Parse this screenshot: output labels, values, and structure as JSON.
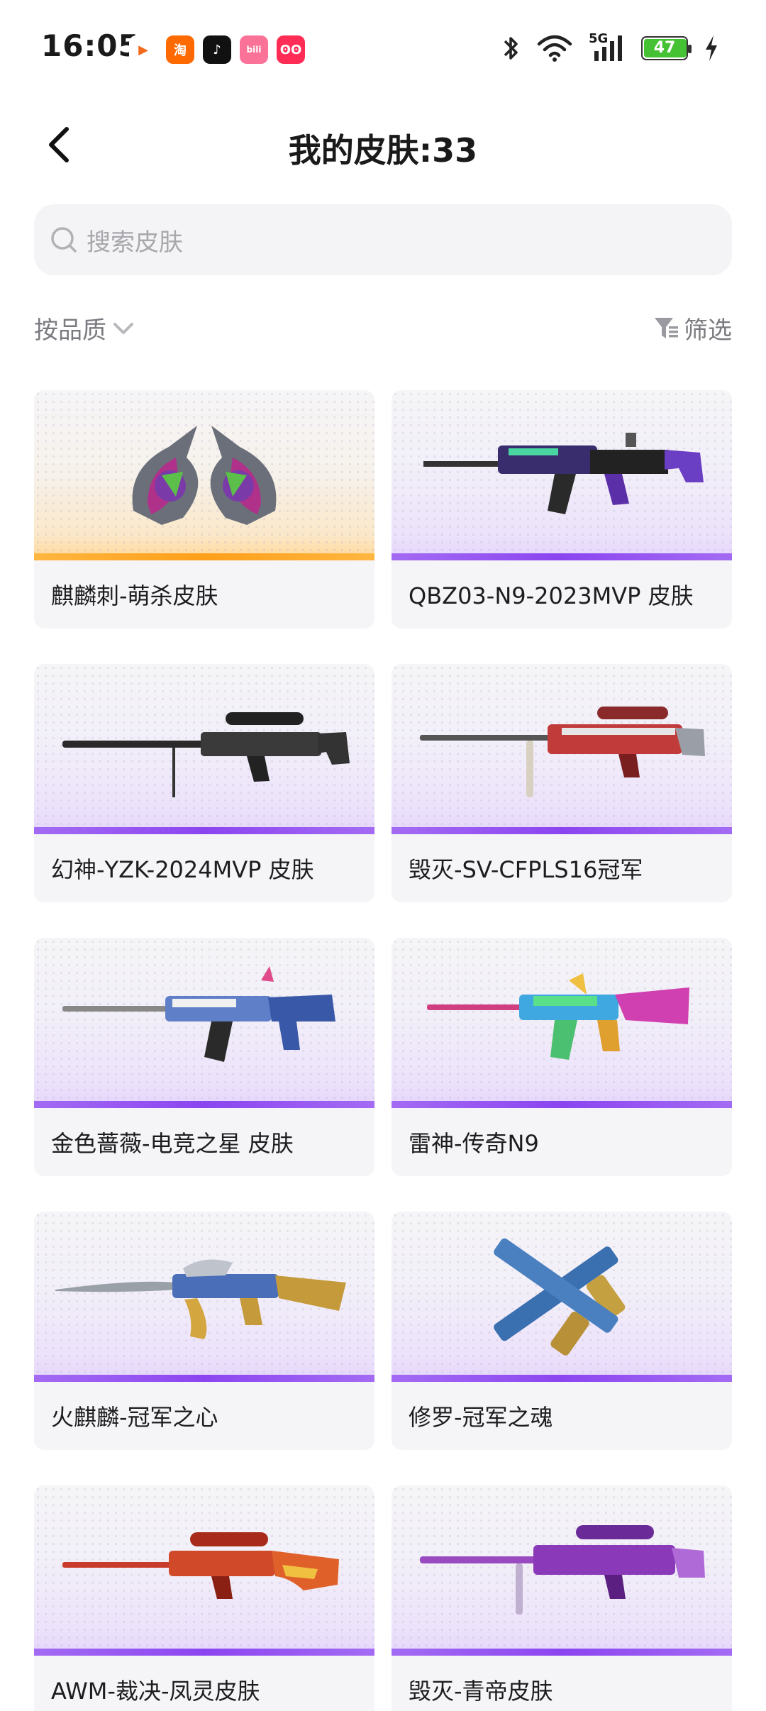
{
  "status_bar": {
    "time": "16:05",
    "apps": [
      {
        "name": "photo-app-icon",
        "glyph": "▶",
        "color": "#ffffff",
        "fg": "#f26b1d"
      },
      {
        "name": "taobao-icon",
        "glyph": "淘",
        "color": "#ff6a00",
        "fg": "#ffffff"
      },
      {
        "name": "douyin-icon",
        "glyph": "♪",
        "color": "#111111",
        "fg": "#ffffff"
      },
      {
        "name": "bilibili-icon",
        "glyph": "bili",
        "color": "#fb7299",
        "fg": "#ffffff"
      },
      {
        "name": "pig-app-icon",
        "glyph": "ʘʘ",
        "color": "#ff2d55",
        "fg": "#ffffff"
      }
    ],
    "network": "5G",
    "battery": "47",
    "battery_level": 0.47
  },
  "header": {
    "title": "我的皮肤:33"
  },
  "search": {
    "placeholder": "搜索皮肤"
  },
  "sort": {
    "label": "按品质"
  },
  "filter": {
    "label": "筛选"
  },
  "colors": {
    "accent_purple": "#8b45f0",
    "accent_gold": "#ff9f1a"
  },
  "skins": [
    {
      "name": "麒麟刺-萌杀皮肤",
      "rarity": "gold",
      "weapon": "dual-blades"
    },
    {
      "name": "QBZ03-N9-2023MVP 皮肤",
      "rarity": "purple",
      "weapon": "rifle-purple"
    },
    {
      "name": "幻神-YZK-2024MVP 皮肤",
      "rarity": "purple",
      "weapon": "sniper-black"
    },
    {
      "name": "毁灭-SV-CFPLS16冠军",
      "rarity": "purple",
      "weapon": "sniper-red"
    },
    {
      "name": "金色蔷薇-电竞之星 皮肤",
      "rarity": "purple",
      "weapon": "rifle-blue"
    },
    {
      "name": "雷神-传奇N9",
      "rarity": "purple",
      "weapon": "rifle-rainbow"
    },
    {
      "name": "火麒麟-冠军之心",
      "rarity": "purple",
      "weapon": "ak-gold"
    },
    {
      "name": "修罗-冠军之魂",
      "rarity": "purple",
      "weapon": "crossed-pistols"
    },
    {
      "name": "AWM-裁决-凤灵皮肤",
      "rarity": "purple",
      "weapon": "awm-red"
    },
    {
      "name": "毁灭-青帝皮肤",
      "rarity": "purple",
      "weapon": "sniper-purple"
    }
  ]
}
